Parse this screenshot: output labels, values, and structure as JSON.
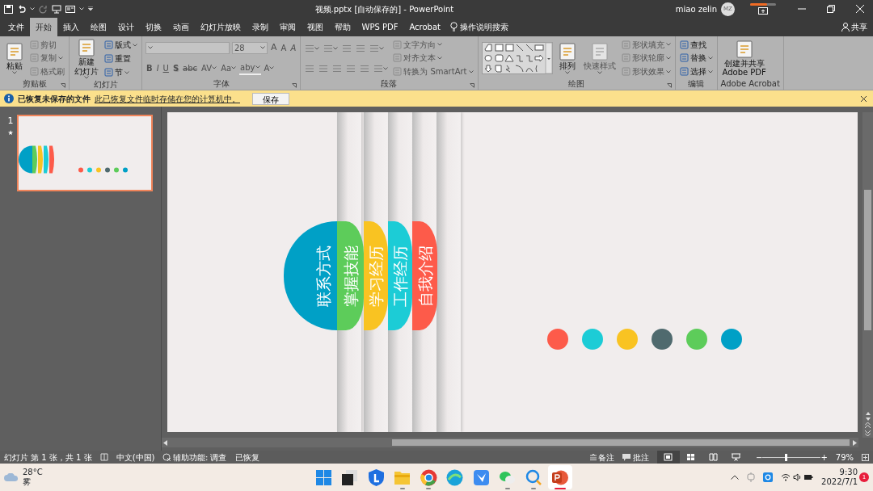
{
  "window": {
    "title": "视频.pptx [自动保存的]  -  PowerPoint",
    "user": "miao zelin",
    "avatar": "MZ",
    "progress": {
      "level": 0.65
    }
  },
  "menu_tabs": [
    {
      "label": "文件",
      "selected": false
    },
    {
      "label": "开始",
      "selected": true
    },
    {
      "label": "插入",
      "selected": false
    },
    {
      "label": "绘图",
      "selected": false
    },
    {
      "label": "设计",
      "selected": false
    },
    {
      "label": "切换",
      "selected": false
    },
    {
      "label": "动画",
      "selected": false
    },
    {
      "label": "幻灯片放映",
      "selected": false
    },
    {
      "label": "录制",
      "selected": false
    },
    {
      "label": "审阅",
      "selected": false
    },
    {
      "label": "视图",
      "selected": false
    },
    {
      "label": "帮助",
      "selected": false
    },
    {
      "label": "WPS PDF",
      "selected": false
    },
    {
      "label": "Acrobat",
      "selected": false
    }
  ],
  "tell_me": "操作说明搜索",
  "share": "共享",
  "ribbon": [
    {
      "label": "剪贴板",
      "launcher": true,
      "columns": [
        [
          [
            {
              "kind": "large",
              "lines": [
                "粘贴"
              ],
              "caret": true,
              "disabled": false
            }
          ]
        ],
        [
          [
            {
              "kind": "small",
              "label": "剪切",
              "caret": false,
              "disabled": true
            }
          ],
          [
            {
              "kind": "small",
              "label": "复制",
              "caret": true,
              "disabled": true
            }
          ],
          [
            {
              "kind": "small",
              "label": "格式刷",
              "caret": false,
              "disabled": true
            }
          ]
        ]
      ]
    },
    {
      "label": "幻灯片",
      "launcher": false,
      "columns": [
        [
          [
            {
              "kind": "large",
              "lines": [
                "新建",
                "幻灯片"
              ],
              "caret": true,
              "disabled": false
            }
          ]
        ],
        [
          [
            {
              "kind": "small",
              "label": "版式",
              "caret": true,
              "disabled": false
            }
          ],
          [
            {
              "kind": "small",
              "label": "重置",
              "caret": false,
              "disabled": false
            }
          ],
          [
            {
              "kind": "small",
              "label": "节",
              "caret": true,
              "disabled": false
            }
          ]
        ]
      ]
    },
    {
      "label": "字体",
      "launcher": true,
      "columns": [
        [
          [
            {
              "kind": "font-field",
              "caret": true,
              "disabled": true
            },
            {
              "kind": "size-field",
              "value": "28",
              "caret": true,
              "disabled": true
            },
            {
              "kind": "glyph",
              "text": "A",
              "caret": false,
              "disabled": true
            },
            {
              "kind": "glyph",
              "text": "A",
              "caret": false,
              "disabled": true
            },
            {
              "kind": "glyph",
              "text": "A",
              "caret": false,
              "disabled": true
            }
          ],
          [
            {
              "kind": "glyph",
              "text": "B",
              "caret": false,
              "disabled": true
            },
            {
              "kind": "glyph",
              "text": "I",
              "caret": false,
              "disabled": true
            },
            {
              "kind": "glyph",
              "text": "U",
              "caret": false,
              "disabled": true
            },
            {
              "kind": "glyph",
              "text": "S",
              "caret": false,
              "disabled": true
            },
            {
              "kind": "glyph",
              "text": "abc",
              "caret": false,
              "disabled": true
            },
            {
              "kind": "glyph",
              "text": "AV",
              "caret": true,
              "disabled": true
            },
            {
              "kind": "glyph",
              "text": "Aa",
              "caret": true,
              "disabled": true
            },
            {
              "kind": "glyph",
              "text": "aby",
              "caret": true,
              "disabled": true
            },
            {
              "kind": "glyph",
              "text": "A",
              "caret": true,
              "disabled": true
            }
          ]
        ]
      ]
    },
    {
      "label": "段落",
      "launcher": true,
      "columns": [
        [
          [
            {
              "kind": "icon",
              "caret": true,
              "disabled": true
            },
            {
              "kind": "icon",
              "caret": true,
              "disabled": true
            },
            {
              "kind": "icon",
              "caret": false,
              "disabled": true
            },
            {
              "kind": "icon",
              "caret": false,
              "disabled": true
            },
            {
              "kind": "icon",
              "caret": true,
              "disabled": true
            }
          ],
          [
            {
              "kind": "icon",
              "caret": false,
              "disabled": true
            },
            {
              "kind": "icon",
              "caret": false,
              "disabled": true
            },
            {
              "kind": "icon",
              "caret": false,
              "disabled": true
            },
            {
              "kind": "icon",
              "caret": false,
              "disabled": true
            },
            {
              "kind": "icon",
              "caret": false,
              "disabled": true
            },
            {
              "kind": "icon",
              "caret": true,
              "disabled": true
            }
          ]
        ],
        [
          [
            {
              "kind": "small",
              "label": "文字方向",
              "caret": true,
              "disabled": true
            }
          ],
          [
            {
              "kind": "small",
              "label": "对齐文本",
              "caret": true,
              "disabled": true
            }
          ],
          [
            {
              "kind": "small",
              "label": "转换为 SmartArt",
              "caret": true,
              "disabled": true
            }
          ]
        ]
      ]
    },
    {
      "label": "绘图",
      "launcher": true,
      "columns": [
        [
          [
            {
              "kind": "gallery"
            }
          ]
        ],
        [
          [
            {
              "kind": "large",
              "lines": [
                "排列"
              ],
              "caret": true,
              "disabled": false
            }
          ]
        ],
        [
          [
            {
              "kind": "large",
              "lines": [
                "快速样式"
              ],
              "caret": true,
              "disabled": true
            }
          ]
        ],
        [
          [
            {
              "kind": "small",
              "label": "形状填充",
              "caret": true,
              "disabled": true
            }
          ],
          [
            {
              "kind": "small",
              "label": "形状轮廓",
              "caret": true,
              "disabled": true
            }
          ],
          [
            {
              "kind": "small",
              "label": "形状效果",
              "caret": true,
              "disabled": true
            }
          ]
        ]
      ]
    },
    {
      "label": "编辑",
      "launcher": false,
      "columns": [
        [
          [
            {
              "kind": "small",
              "label": "查找",
              "caret": false,
              "disabled": false
            }
          ],
          [
            {
              "kind": "small",
              "label": "替换",
              "caret": true,
              "disabled": false
            }
          ],
          [
            {
              "kind": "small",
              "label": "选择",
              "caret": true,
              "disabled": false
            }
          ]
        ]
      ]
    },
    {
      "label": "Adobe Acrobat",
      "launcher": false,
      "columns": [
        [
          [
            {
              "kind": "large",
              "lines": [
                "创建并共享",
                "Adobe PDF"
              ],
              "caret": false,
              "disabled": false
            }
          ]
        ]
      ]
    }
  ],
  "info_bar": {
    "title": "已恢复未保存的文件",
    "link": "此已恢复文件临时存储在您的计算机中。",
    "button": "保存"
  },
  "thumbnails": [
    {
      "number": "1",
      "star": "★",
      "selected": true
    }
  ],
  "slide": {
    "tabs": [
      {
        "label": "联系方式",
        "color": "#00a0c6"
      },
      {
        "label": "掌握技能",
        "color": "#5dcc5a"
      },
      {
        "label": "学习经历",
        "color": "#f9c322"
      },
      {
        "label": "工作经历",
        "color": "#1cccd6"
      },
      {
        "label": "自我介绍",
        "color": "#fd5b4a"
      }
    ],
    "dots": [
      {
        "color": "#fd5b4a"
      },
      {
        "color": "#1cccd6"
      },
      {
        "color": "#f9c322"
      },
      {
        "color": "#4f6a6e"
      },
      {
        "color": "#5dcc5a"
      },
      {
        "color": "#00a0c6"
      }
    ]
  },
  "status_bar": {
    "slide_info": "幻灯片 第 1 张，共 1 张",
    "language": "中文(中国)",
    "accessibility": "辅助功能: 调查",
    "recovered": "已恢复",
    "notes": "备注",
    "comments": "批注",
    "views": [
      {
        "selected": true
      },
      {
        "selected": false
      },
      {
        "selected": false
      },
      {
        "selected": false
      }
    ],
    "zoom_out": "−",
    "zoom": {
      "level": 0.4
    },
    "zoom_in": "+",
    "zoom_value": "79%"
  },
  "taskbar": {
    "weather": {
      "temp": "28°C",
      "condition": "雾"
    },
    "apps": [
      {
        "running": false,
        "active": false
      },
      {
        "running": false,
        "active": false
      },
      {
        "running": false,
        "active": false
      },
      {
        "running": true,
        "active": false
      },
      {
        "running": true,
        "active": false
      },
      {
        "running": false,
        "active": false
      },
      {
        "running": false,
        "active": false
      },
      {
        "running": true,
        "active": false
      },
      {
        "running": true,
        "active": false
      },
      {
        "running": true,
        "active": true
      }
    ],
    "time": "9:30",
    "date": "2022/7/1",
    "notifications": "1"
  }
}
